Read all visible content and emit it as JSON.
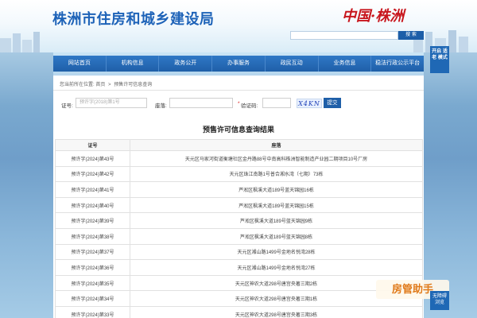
{
  "header": {
    "title": "株洲市住房和城乡建设局",
    "brand": "中国·株洲",
    "search_button": "搜 索"
  },
  "nav": {
    "items": [
      "网站首页",
      "机构信息",
      "政务公开",
      "办事服务",
      "政民互动",
      "业务信息",
      "稳法行政公示平台"
    ]
  },
  "breadcrumb": {
    "prefix": "您当前所在位置:",
    "home": "首页",
    "separator": ">",
    "current": "预售许可信息查询"
  },
  "form": {
    "cert_label": "证号:",
    "cert_placeholder": "预许字(2018)第1号",
    "building_label": "座落:",
    "captcha_label": "验证码:",
    "captcha_required_mark": "*",
    "captcha_text": "X4KN",
    "submit_label": "提交"
  },
  "results": {
    "title": "预售许可信息查询结果",
    "columns": [
      "证号",
      "座落"
    ],
    "rows": [
      [
        "预许字(2024)第43号",
        "天元区马家河街道衡塘社区金丹路88号中南高科株洲智能制造产业园二期项目10号厂房"
      ],
      [
        "预许字(2024)第42号",
        "天元区珠江南路1号普合湘水湾（七期）73栋"
      ],
      [
        "预许字(2024)第41号",
        "芦淞区枫溪大道189号蓝天锦园16栋"
      ],
      [
        "预许字(2024)第40号",
        "芦淞区枫溪大道189号蓝天锦园15栋"
      ],
      [
        "预许字(2024)第39号",
        "芦淞区枫溪大道189号蓝天锦园9栋"
      ],
      [
        "预许字(2024)第38号",
        "芦淞区枫溪大道189号蓝天锦园8栋"
      ],
      [
        "预许字(2024)第37号",
        "天元区湘山路1499号金地名悦湾28栋"
      ],
      [
        "预许字(2024)第36号",
        "天元区湘山路1499号金地名悦湾27栋"
      ],
      [
        "预许字(2024)第35号",
        "天元区神农大道298号唐宫央著三期2栋"
      ],
      [
        "预许字(2024)第34号",
        "天元区神农大道298号唐宫央著三期1栋"
      ],
      [
        "预许字(2024)第33号",
        "天元区神农大道298号唐宫央著三期3栋"
      ]
    ]
  },
  "sidebar": {
    "float_top": "开启 适老 模式",
    "float_bottom": "无障碍 浏览"
  },
  "app_badge": "房管助手"
}
